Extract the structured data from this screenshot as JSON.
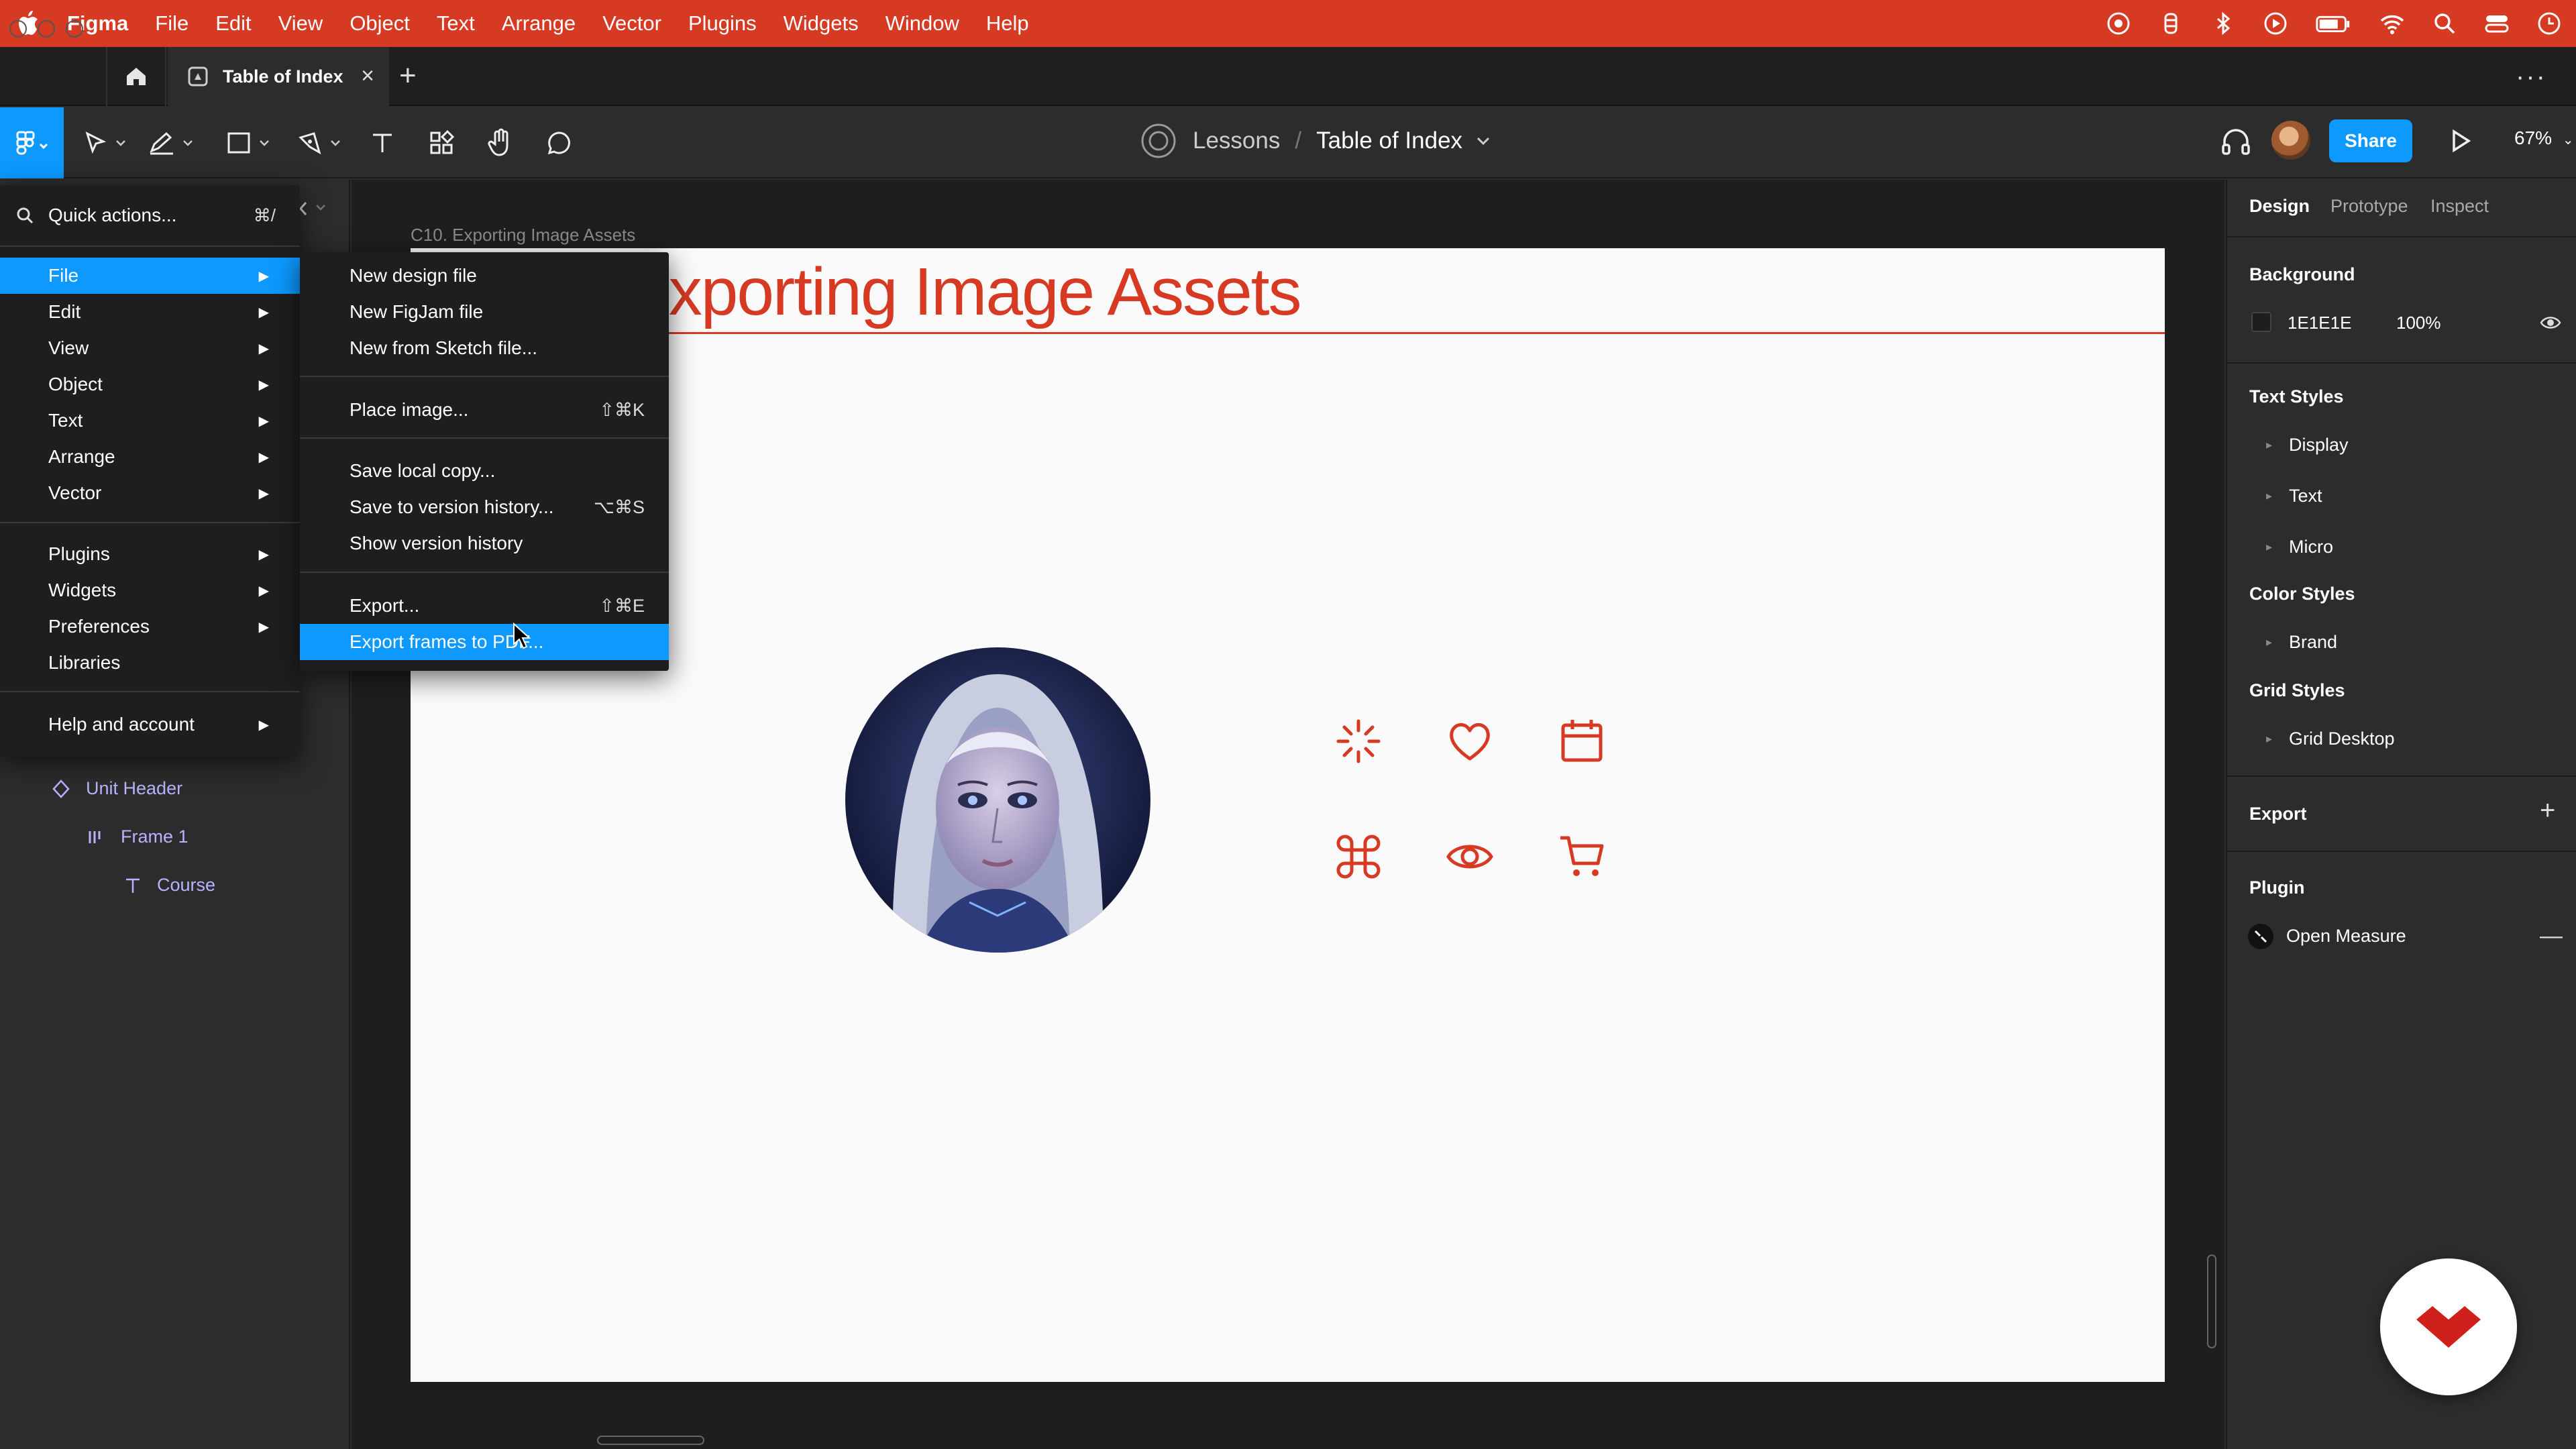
{
  "menubar": {
    "app": "Figma",
    "items": [
      "File",
      "Edit",
      "View",
      "Object",
      "Text",
      "Arrange",
      "Vector",
      "Plugins",
      "Widgets",
      "Window",
      "Help"
    ]
  },
  "tab": {
    "title": "Table of Index"
  },
  "breadcrumb": {
    "project": "Lessons",
    "separator": "/",
    "file": "Table of Index"
  },
  "toolbar": {
    "share_label": "Share",
    "zoom": "67%"
  },
  "main_menu": {
    "quick_actions": "Quick actions...",
    "quick_actions_shortcut": "⌘/",
    "items": [
      "File",
      "Edit",
      "View",
      "Object",
      "Text",
      "Arrange",
      "Vector",
      "Plugins",
      "Widgets",
      "Preferences",
      "Libraries",
      "Help and account"
    ]
  },
  "file_menu": {
    "items": [
      {
        "label": "New design file",
        "shortcut": ""
      },
      {
        "label": "New FigJam file",
        "shortcut": ""
      },
      {
        "label": "New from Sketch file...",
        "shortcut": ""
      },
      {
        "label": "Place image...",
        "shortcut": "⇧⌘K"
      },
      {
        "label": "Save local copy...",
        "shortcut": ""
      },
      {
        "label": "Save to version history...",
        "shortcut": "⌥⌘S"
      },
      {
        "label": "Show version history",
        "shortcut": ""
      },
      {
        "label": "Export...",
        "shortcut": "⇧⌘E"
      },
      {
        "label": "Export frames to PDF...",
        "shortcut": ""
      }
    ]
  },
  "layers": [
    {
      "label": "Unit Header",
      "icon": "component-icon"
    },
    {
      "label": "Frame 1",
      "icon": "frame-icon"
    },
    {
      "label": "Course",
      "icon": "text-icon"
    }
  ],
  "canvas": {
    "frame_label": "C10. Exporting Image Assets",
    "frame_title": "Exporting Image Assets",
    "accent": "#d63a23"
  },
  "right_panel": {
    "tabs": [
      "Design",
      "Prototype",
      "Inspect"
    ],
    "background": {
      "label": "Background",
      "hex": "1E1E1E",
      "opacity": "100%"
    },
    "text_styles": {
      "label": "Text Styles",
      "items": [
        "Display",
        "Text",
        "Micro"
      ]
    },
    "color_styles": {
      "label": "Color Styles",
      "items": [
        "Brand"
      ]
    },
    "grid_styles": {
      "label": "Grid Styles",
      "items": [
        "Grid Desktop"
      ]
    },
    "export": {
      "label": "Export"
    },
    "plugin": {
      "label": "Plugin",
      "item": "Open Measure"
    }
  },
  "colors": {
    "figma_blue": "#0d99ff",
    "menubar_red": "#d63a23"
  }
}
